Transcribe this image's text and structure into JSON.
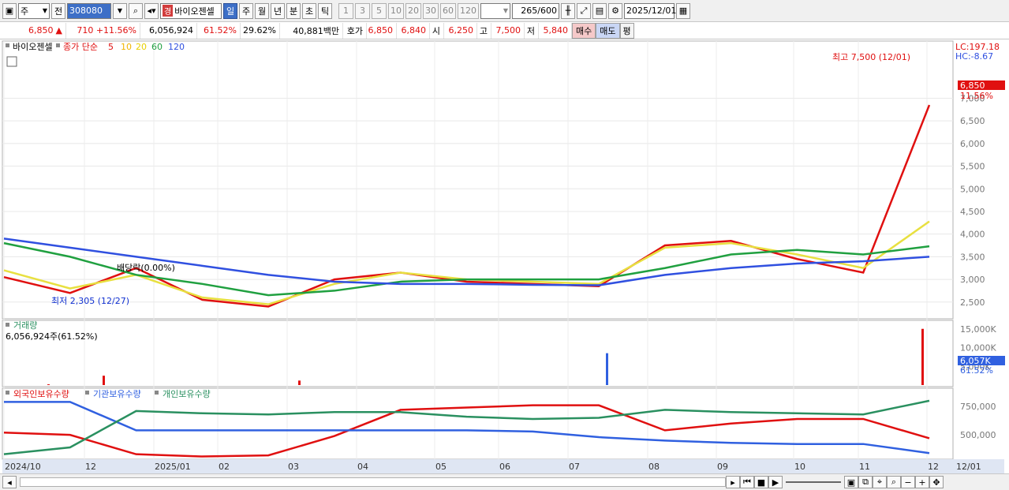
{
  "toolbar": {
    "period_type": "주",
    "all_label": "전",
    "code": "308080",
    "name_badge": "경",
    "name": "바이오젠셀",
    "tf_day": "일",
    "tf_week": "주",
    "tf_month": "월",
    "tf_year": "년",
    "tf_min": "분",
    "tf_sec": "초",
    "tf_tick": "틱",
    "periods": [
      "1",
      "3",
      "5",
      "10",
      "20",
      "30",
      "60",
      "120"
    ],
    "count": "265",
    "count_total": "/600",
    "date": "2025/12/01"
  },
  "info": {
    "price": "6,850",
    "change": "710",
    "change_pct": "+11.56%",
    "volume": "6,056,924",
    "vol_ratio": "61.52%",
    "turnover": "29.62%",
    "amount": "40,881백만",
    "quote_label": "호가",
    "quote_value": "6,850",
    "quote_value2": "6,840",
    "open_label": "시",
    "open_value": "6,250",
    "high_label": "고",
    "high_value": "7,500",
    "low_label": "저",
    "low_value": "5,840",
    "buy_label": "매수",
    "sell_label": "매도",
    "avg_label": "평"
  },
  "price_panel": {
    "stock_label": "바이오젠셀",
    "ma_title": "종가 단순",
    "ma_periods": [
      "5",
      "10",
      "20",
      "60",
      "120"
    ],
    "ma_colors": [
      "#e01010",
      "#f0b400",
      "#f0e040",
      "#20a040",
      "#3050e0"
    ],
    "lc_label": "LC:197.18",
    "hc_label": "HC:-8.67",
    "high_note": "최고 7,500 (12/01)",
    "low_note": "최저 2,305 (12/27)",
    "mid_note": "배당락(0.00%)",
    "current_tag": "6,850",
    "current_pct": "11.56%",
    "y_ticks": [
      "7,000",
      "6,500",
      "6,000",
      "5,500",
      "5,000",
      "4,500",
      "4,000",
      "3,500",
      "3,000",
      "2,500"
    ]
  },
  "volume_panel": {
    "title": "거래량",
    "value_note": "6,056,924주(61.52%)",
    "y_ticks": [
      "15,000K",
      "10,000K",
      "5,000K"
    ],
    "current_tag": "6,057K",
    "current_pct": "61.52%"
  },
  "holdings_panel": {
    "series": [
      "외국인보유수량",
      "기관보유수량",
      "개인보유수량"
    ],
    "colors": [
      "#e01010",
      "#3060e0",
      "#2a9060"
    ],
    "y_ticks": [
      "750,000",
      "500,000"
    ]
  },
  "x_axis": {
    "labels": [
      "2024/10",
      "12",
      "2025/01",
      "02",
      "03",
      "04",
      "05",
      "06",
      "07",
      "08",
      "09",
      "10",
      "11",
      "12",
      "12/01"
    ]
  },
  "chart_data": [
    {
      "type": "line",
      "title": "",
      "x": [
        "2024/10",
        "2024/11",
        "2024/12",
        "2025/01",
        "2025/02",
        "2025/03",
        "2025/04",
        "2025/05",
        "2025/06",
        "2025/07",
        "2025/08",
        "2025/09",
        "2025/10",
        "2025/11",
        "2025/12"
      ],
      "series": [
        {
          "name": "5",
          "values": [
            3050,
            2700,
            3250,
            2550,
            2400,
            3000,
            3150,
            2950,
            2900,
            2850,
            3750,
            3850,
            3450,
            3150,
            6850
          ]
        },
        {
          "name": "20",
          "values": [
            3200,
            2800,
            3100,
            2600,
            2450,
            2900,
            3150,
            3000,
            2950,
            2900,
            3700,
            3800,
            3550,
            3250,
            4280
          ]
        },
        {
          "name": "60",
          "values": [
            3800,
            3500,
            3100,
            2900,
            2650,
            2750,
            2950,
            3000,
            3000,
            3000,
            3250,
            3550,
            3650,
            3550,
            3730
          ]
        },
        {
          "name": "120",
          "values": [
            3900,
            3700,
            3500,
            3300,
            3100,
            2950,
            2900,
            2900,
            2880,
            2870,
            3100,
            3250,
            3350,
            3400,
            3500
          ]
        }
      ],
      "ylim": [
        2200,
        7600
      ]
    },
    {
      "type": "bar",
      "title": "",
      "categories": [
        "2024/11",
        "2024/12",
        "2025/03",
        "2025/07",
        "2025/12"
      ],
      "values": [
        200,
        2500,
        1200,
        8500,
        15000
      ],
      "ylim": [
        0,
        16000
      ]
    },
    {
      "type": "line",
      "title": "",
      "x": [
        "2024/10",
        "2024/11",
        "2024/12",
        "2025/01",
        "2025/02",
        "2025/03",
        "2025/04",
        "2025/05",
        "2025/06",
        "2025/07",
        "2025/08",
        "2025/09",
        "2025/10",
        "2025/11",
        "2025/12"
      ],
      "series": [
        {
          "name": "외국인보유수량",
          "values": [
            520000,
            500000,
            330000,
            310000,
            320000,
            490000,
            720000,
            740000,
            760000,
            760000,
            540000,
            600000,
            640000,
            640000,
            470000
          ]
        },
        {
          "name": "기관보유수량",
          "values": [
            790000,
            790000,
            540000,
            540000,
            540000,
            540000,
            540000,
            540000,
            530000,
            480000,
            450000,
            430000,
            420000,
            420000,
            340000
          ]
        },
        {
          "name": "개인보유수량",
          "values": [
            330000,
            390000,
            710000,
            690000,
            680000,
            700000,
            700000,
            660000,
            640000,
            650000,
            720000,
            700000,
            690000,
            680000,
            800000
          ]
        }
      ],
      "ylim": [
        300000,
        820000
      ]
    }
  ]
}
